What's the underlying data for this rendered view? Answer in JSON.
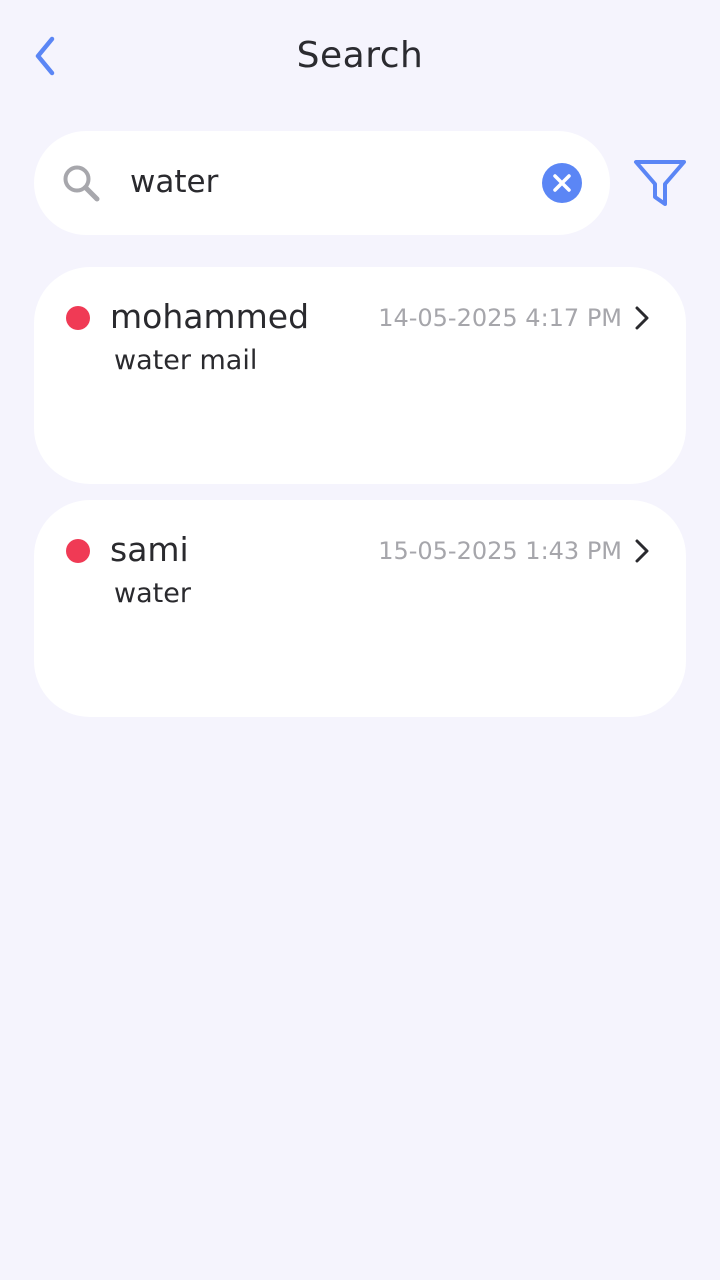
{
  "header": {
    "title": "Search",
    "back_icon": "chevron-left-icon"
  },
  "search": {
    "value": "water",
    "placeholder": "",
    "search_icon": "search-icon",
    "clear_icon": "clear-icon",
    "filter_icon": "filter-icon"
  },
  "colors": {
    "accent": "#5b86f5",
    "unread_dot": "#f03a55",
    "background": "#f5f4fd",
    "card": "#ffffff"
  },
  "results": [
    {
      "sender": "mohammed",
      "subject": "water mail",
      "timestamp": "14-05-2025 4:17 PM",
      "unread": true
    },
    {
      "sender": "sami",
      "subject": "water",
      "timestamp": "15-05-2025 1:43 PM",
      "unread": true
    }
  ]
}
